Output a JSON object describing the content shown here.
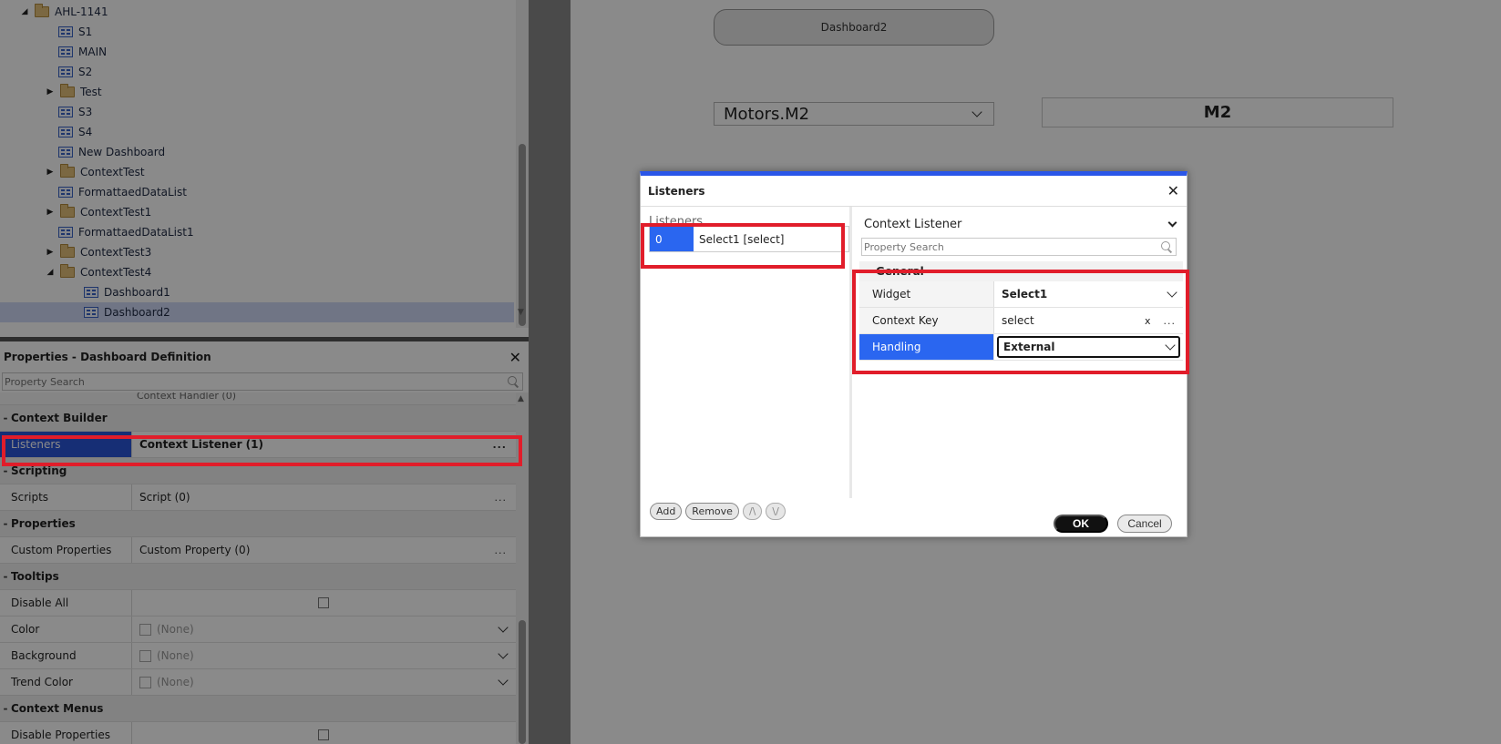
{
  "tree": {
    "items": [
      {
        "label": "AHL-1141",
        "type": "folder",
        "arrow": "◢"
      },
      {
        "label": "S1",
        "type": "dashboard"
      },
      {
        "label": "MAIN",
        "type": "dashboard"
      },
      {
        "label": "S2",
        "type": "dashboard"
      },
      {
        "label": "Test",
        "type": "folder",
        "arrow": "▶"
      },
      {
        "label": "S3",
        "type": "dashboard"
      },
      {
        "label": "S4",
        "type": "dashboard"
      },
      {
        "label": "New Dashboard",
        "type": "dashboard"
      },
      {
        "label": "ContextTest",
        "type": "folder",
        "arrow": "▶"
      },
      {
        "label": "FormattaedDataList",
        "type": "dashboard"
      },
      {
        "label": "ContextTest1",
        "type": "folder",
        "arrow": "▶"
      },
      {
        "label": "FormattaedDataList1",
        "type": "dashboard"
      },
      {
        "label": "ContextTest3",
        "type": "folder",
        "arrow": "▶"
      },
      {
        "label": "ContextTest4",
        "type": "folder",
        "arrow": "◢"
      },
      {
        "label": "Dashboard1",
        "type": "dashboard"
      },
      {
        "label": "Dashboard2",
        "type": "dashboard",
        "selected": true
      }
    ]
  },
  "properties": {
    "title": "Properties - Dashboard Definition",
    "search_placeholder": "Property Search",
    "cut_row": "Context Handler (0)",
    "context_builder": {
      "label": "Context Builder",
      "listeners_name": "Listeners",
      "listeners_value": "Context Listener (1)"
    },
    "scripting": {
      "label": "Scripting",
      "scripts_name": "Scripts",
      "scripts_value": "Script (0)"
    },
    "props_section": {
      "label": "Properties",
      "custom_name": "Custom Properties",
      "custom_value": "Custom Property (0)"
    },
    "tooltips": {
      "label": "Tooltips",
      "disable_all": "Disable All",
      "color": "Color",
      "background": "Background",
      "trend_color": "Trend Color",
      "none": "(None)"
    },
    "context_menus": {
      "label": "Context Menus",
      "disable_properties": "Disable Properties"
    },
    "ellipsis": "..."
  },
  "canvas": {
    "button_label": "Dashboard2",
    "select_value": "Motors.M2",
    "label_value": "M2"
  },
  "dialog": {
    "title": "Listeners",
    "left_label": "Listeners",
    "listener": {
      "index": "0",
      "name": "Select1 [select]"
    },
    "buttons": {
      "add": "Add",
      "remove": "Remove",
      "up": "/\\",
      "down": "\\/"
    },
    "type_select": "Context Listener",
    "search_placeholder": "Property Search",
    "general": {
      "label": "General",
      "widget_name": "Widget",
      "widget_value": "Select1",
      "key_name": "Context Key",
      "key_value": "select",
      "key_clear": "x",
      "key_more": "...",
      "handling_name": "Handling",
      "handling_value": "External"
    },
    "ok": "OK",
    "cancel": "Cancel"
  },
  "colors": {
    "selection_blue": "#2a56d8",
    "highlight_red": "#e11d2a",
    "dialog_accent": "#2a56e8"
  }
}
